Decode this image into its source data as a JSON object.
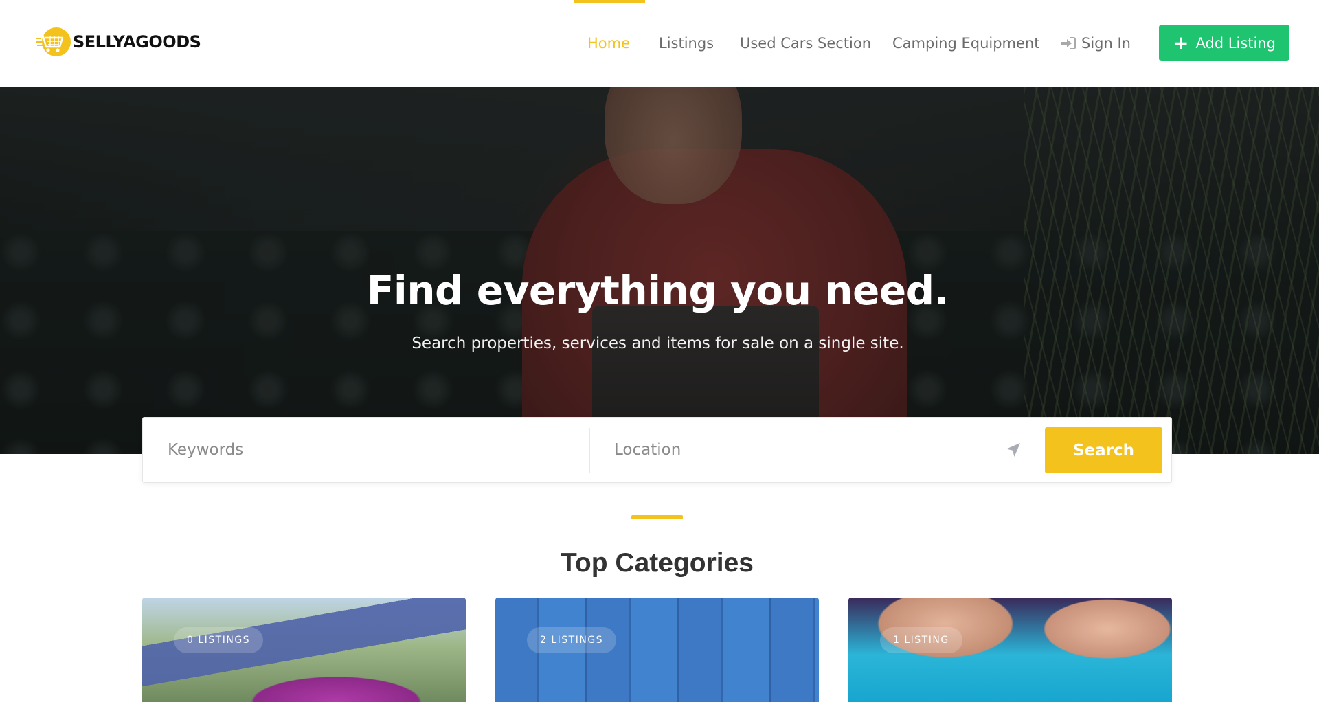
{
  "brand": {
    "name": "SELLYAGOODS",
    "accent": "#f4c21d",
    "cta_color": "#1ec46f"
  },
  "nav": {
    "items": [
      {
        "label": "Home",
        "active": true
      },
      {
        "label": "Listings",
        "active": false
      },
      {
        "label": "Used Cars Section",
        "active": false
      },
      {
        "label": "Camping Equipment",
        "active": false
      }
    ],
    "sign_in": {
      "label": "Sign In",
      "icon": "sign-in-icon"
    },
    "add_listing": {
      "label": "Add Listing",
      "icon": "plus-icon"
    }
  },
  "hero": {
    "title": "Find everything you need.",
    "subtitle": "Search properties, services and items for sale on a single site."
  },
  "search": {
    "keywords_placeholder": "Keywords",
    "keywords_value": "",
    "location_placeholder": "Location",
    "location_value": "",
    "locate_icon": "location-arrow-icon",
    "button_label": "Search"
  },
  "categories_section": {
    "title": "Top Categories",
    "cards": [
      {
        "badge": "0 LISTINGS"
      },
      {
        "badge": "2 LISTINGS"
      },
      {
        "badge": "1 LISTING"
      }
    ]
  }
}
